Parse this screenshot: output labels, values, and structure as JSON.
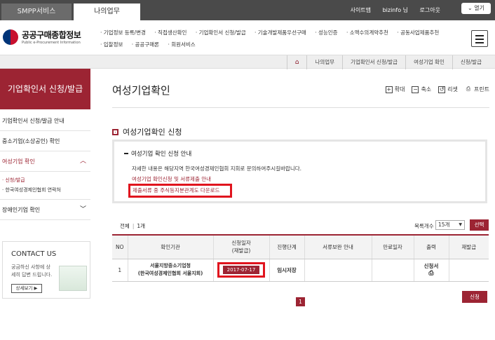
{
  "header": {
    "tabs": [
      "SMPP서비스",
      "나의업무"
    ],
    "links": [
      "사이트맵",
      "bizinfo 님",
      "로그아웃"
    ],
    "open_label": "열기",
    "logo_ko": "공공구매종합정보",
    "logo_en": "Public e-Procurement Information",
    "gnb": [
      "· 기업정보 등록/변경",
      "· 직접생산확인",
      "· 기업확인서 신청/발급",
      "· 기술개발제품우선구매",
      "· 성능인증",
      "· 소액수의계약추천",
      "· 공동사업제품추천",
      "· 입찰정보",
      "· 공공구매론",
      "· 회원서비스"
    ]
  },
  "breadcrumb": [
    "나의업무",
    "기업확인서 신청/발급",
    "여성기업 확인",
    "신청/발급"
  ],
  "sidebar": {
    "title": "기업확인서 신청/발급",
    "items": [
      {
        "label": "기업확인서 신청/발급 안내"
      },
      {
        "label": "중소기업(소상공인) 확인"
      },
      {
        "label": "여성기업 확인"
      },
      {
        "label": "장애인기업 확인"
      }
    ],
    "sub": [
      "· 신청/발급",
      "· 한국여성경제인협회 연락처"
    ],
    "contact_title": "CONTACT US",
    "contact_desc": "궁금하신 사항에 상세히 답변 드립니다.",
    "contact_btn": "상세보기 ▶"
  },
  "page": {
    "title": "여성기업확인",
    "tools": [
      "확대",
      "축소",
      "리셋",
      "프린트"
    ]
  },
  "section": {
    "title": "여성기업확인 신청",
    "notice_heading": "여성기업 확인 신청 안내",
    "notice_text": "자세한 내용은 해당지역 한국여성경제인협회 지회로 문의하여주시길바랍니다.",
    "link1": "여성기업 확인신청 및 서류제출 안내",
    "link2": "제출서류 중 주식등지분관계도 다운로드"
  },
  "list": {
    "total_label": "전체",
    "count": "1개",
    "page_size_label": "목록개수",
    "page_size": "15개",
    "select_btn": "선택",
    "headers": [
      "NO",
      "확인기관",
      "신청일자\n(재발급)",
      "진행단계",
      "서류보완 안내",
      "만료일자",
      "출력",
      "재발급"
    ],
    "rows": [
      {
        "no": "1",
        "org_line1": "서울지방중소기업청",
        "org_line2": "(한국여성경제인협회 서울지회)",
        "date": "2017-07-17",
        "stage": "임시저장",
        "doc": "",
        "expire": "",
        "print": "신청서",
        "reissue": ""
      }
    ],
    "request_btn": "신청",
    "page": "1"
  }
}
